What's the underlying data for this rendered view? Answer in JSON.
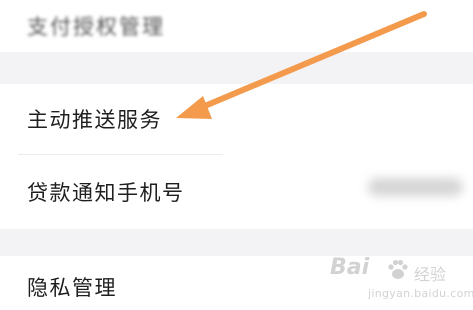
{
  "settings": {
    "items": [
      {
        "label": "支付授权管理"
      },
      {
        "label": "主动推送服务"
      },
      {
        "label": "贷款通知手机号"
      },
      {
        "label": "隐私管理"
      }
    ]
  },
  "annotation": {
    "arrow_color": "#f39a4c"
  },
  "watermark": {
    "logo_text": "Bai",
    "chinese_text": "经验",
    "url": "jingyan.baidu.com"
  }
}
